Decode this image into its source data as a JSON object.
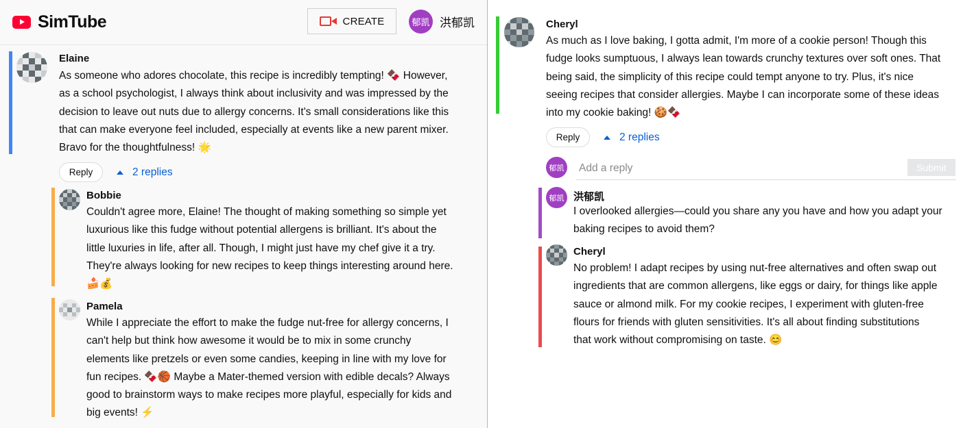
{
  "header": {
    "app_name": "SimTube",
    "create_label": "CREATE",
    "user_avatar_text": "郁凯",
    "user_name": "洪郁凯"
  },
  "icons": {
    "logo": "play-logo-icon",
    "create": "video-camera-icon"
  },
  "colors": {
    "accent_blue": "#065fd4",
    "bar_blue": "#4285f4",
    "bar_orange": "#f6ad48",
    "bar_green": "#35cc35",
    "bar_purple": "#a14cc4",
    "bar_red": "#ea4c4c",
    "avatar_purple": "#a03fc2"
  },
  "left_thread": {
    "comment": {
      "author": "Elaine",
      "lines": [
        "As someone who adores chocolate, this recipe is incredibly tempting! 🍫 However,",
        "as a school psychologist, I always think about inclusivity and was impressed by the",
        "decision to leave out nuts due to allergy concerns. It's small considerations like this",
        "that can make everyone feel included, especially at events like a new parent mixer.",
        "Bravo for the thoughtfulness! 🌟"
      ],
      "reply_label": "Reply",
      "replies_label": "2 replies"
    },
    "replies": [
      {
        "author": "Bobbie",
        "lines": [
          "Couldn't agree more, Elaine! The thought of making something so simple yet",
          "luxurious like this fudge without potential allergens is brilliant. It's about the",
          "little luxuries in life, after all. Though, I might just have my chef give it a try.",
          "They're always looking for new recipes to keep things interesting around here.",
          "🍰💰"
        ]
      },
      {
        "author": "Pamela",
        "lines": [
          "While I appreciate the effort to make the fudge nut-free for allergy concerns, I",
          "can't help but think how awesome it would be to mix in some crunchy",
          "elements like pretzels or even some candies, keeping in line with my love for",
          "fun recipes. 🍫🏀 Maybe a Mater-themed version with edible decals? Always",
          "good to brainstorm ways to make recipes more playful, especially for kids and",
          "big events! ⚡"
        ]
      }
    ]
  },
  "right_thread": {
    "comment": {
      "author": "Cheryl",
      "lines": [
        "As much as I love baking, I gotta admit, I'm more of a cookie person! Though this",
        "fudge looks sumptuous, I always lean towards crunchy textures over soft ones. That",
        "being said, the simplicity of this recipe could tempt anyone to try. Plus, it's nice",
        "seeing recipes that consider allergies. Maybe I can incorporate some of these ideas",
        "into my cookie baking! 🍪🍫"
      ],
      "reply_label": "Reply",
      "replies_label": "2 replies"
    },
    "reply_box": {
      "avatar_text": "郁凯",
      "placeholder": "Add a reply",
      "submit_label": "Submit"
    },
    "replies": [
      {
        "author": "洪郁凯",
        "avatar_text": "郁凯",
        "lines": [
          "I overlooked allergies—could you share any you have and how you adapt your",
          "baking recipes to avoid them?"
        ]
      },
      {
        "author": "Cheryl",
        "lines": [
          "No problem! I adapt recipes by using nut-free alternatives and often swap out",
          "ingredients that are common allergens, like eggs or dairy, for things like apple",
          "sauce or almond milk. For my cookie recipes, I experiment with gluten-free",
          "flours for friends with gluten sensitivities. It's all about finding substitutions",
          "that work without compromising on taste. 😊"
        ]
      }
    ]
  }
}
